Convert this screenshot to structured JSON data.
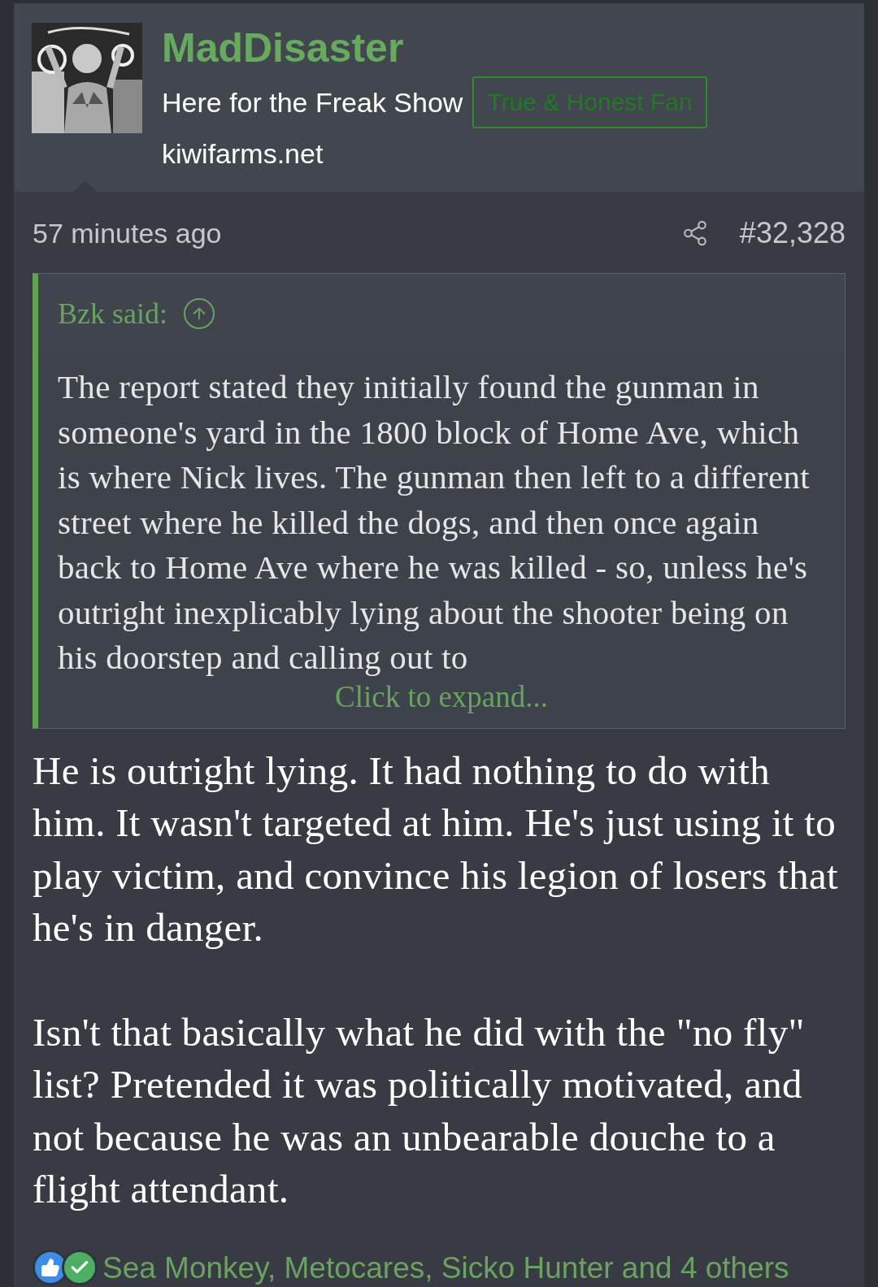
{
  "post": {
    "author": {
      "name": "MadDisaster",
      "title": "Here for the Freak Show",
      "badge": "True & Honest Fan",
      "site": "kiwifarms.net"
    },
    "time": "57 minutes ago",
    "number": "#32,328",
    "quote": {
      "author": "Bzk said:",
      "text": "The report stated they initially found the gunman in someone's yard in the 1800 block of Home Ave, which is where Nick lives. The gunman then left to a different street where he killed the dogs, and then once again back to Home Ave where he was killed - so, unless he's outright inexplicably lying about the shooter being on his doorstep and calling out to",
      "expand": "Click to expand..."
    },
    "paragraphs": [
      "He is outright lying. It had nothing to do with him. It wasn't targeted at him. He's just using it to play victim, and convince his legion of losers that he's in danger.",
      "Isn't that basically what he did with the \"no fly\" list? Pretended it was politically motivated, and not because he was an unbearable douche to a flight attendant."
    ],
    "reactions": {
      "icons": [
        {
          "kind": "like"
        },
        {
          "kind": "agree"
        }
      ],
      "text": "Sea Monkey, Metocares, Sicko Hunter and 4 others"
    }
  }
}
